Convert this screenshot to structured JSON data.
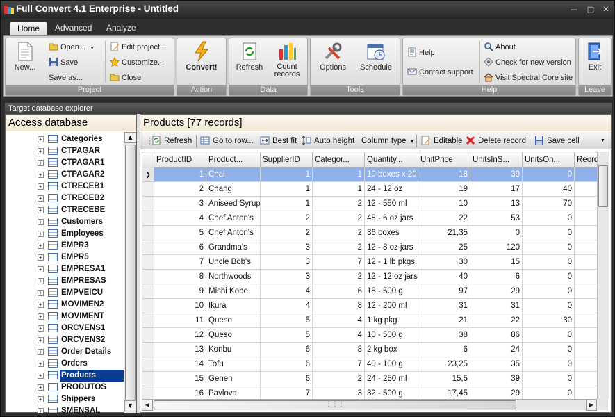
{
  "window": {
    "title": "Full Convert 4.1 Enterprise - Untitled"
  },
  "tabs": [
    {
      "label": "Home"
    },
    {
      "label": "Advanced"
    },
    {
      "label": "Analyze"
    }
  ],
  "ribbon": {
    "groups": {
      "project": "Project",
      "action": "Action",
      "data": "Data",
      "tools": "Tools",
      "help": "Help",
      "leave": "Leave"
    },
    "new": "New...",
    "open": "Open...",
    "save": "Save",
    "save_as": "Save as...",
    "edit_project": "Edit project...",
    "customize": "Customize...",
    "close": "Close",
    "convert": "Convert!",
    "refresh": "Refresh",
    "count_records_1": "Count",
    "count_records_2": "records",
    "options": "Options",
    "schedule": "Schedule",
    "help": "Help",
    "contact_support": "Contact support",
    "about": "About",
    "check_version": "Check for new version",
    "visit_site": "Visit Spectral Core site",
    "exit": "Exit"
  },
  "explorer": {
    "title": "Target database explorer",
    "db_title": "Access database",
    "tables": [
      "Categories",
      "CTPAGAR",
      "CTPAGAR1",
      "CTPAGAR2",
      "CTRECEB1",
      "CTRECEB2",
      "CTRECEBE",
      "Customers",
      "Employees",
      "EMPR3",
      "EMPR5",
      "EMPRESA1",
      "EMPRESAS",
      "EMPVEICU",
      "MOVIMEN2",
      "MOVIMENT",
      "ORCVENS1",
      "ORCVENS2",
      "Order Details",
      "Orders",
      "Products",
      "PRODUTOS",
      "Shippers",
      "SMENSAL"
    ],
    "selected": "Products"
  },
  "grid_panel": {
    "title": "Products [77 records]",
    "toolbar": {
      "refresh": "Refresh",
      "go_to_row": "Go to row...",
      "best_fit": "Best fit",
      "auto_height": "Auto height",
      "column_type": "Column type",
      "editable": "Editable",
      "delete_record": "Delete record",
      "save_cell": "Save cell"
    },
    "columns": [
      "ProductID",
      "Product...",
      "SupplierID",
      "Categor...",
      "Quantity...",
      "UnitPrice",
      "UnitsInS...",
      "UnitsOn...",
      "Reorde"
    ],
    "rows": [
      [
        "1",
        "Chai",
        "1",
        "1",
        "10 boxes x 20",
        "18",
        "39",
        "0"
      ],
      [
        "2",
        "Chang",
        "1",
        "1",
        "24 - 12 oz",
        "19",
        "17",
        "40"
      ],
      [
        "3",
        "Aniseed Syrup",
        "1",
        "2",
        "12 - 550 ml",
        "10",
        "13",
        "70"
      ],
      [
        "4",
        "Chef Anton's",
        "2",
        "2",
        "48 - 6 oz jars",
        "22",
        "53",
        "0"
      ],
      [
        "5",
        "Chef Anton's",
        "2",
        "2",
        "36 boxes",
        "21,35",
        "0",
        "0"
      ],
      [
        "6",
        "Grandma's",
        "3",
        "2",
        "12 - 8 oz jars",
        "25",
        "120",
        "0"
      ],
      [
        "7",
        "Uncle Bob's",
        "3",
        "7",
        "12 - 1 lb pkgs.",
        "30",
        "15",
        "0"
      ],
      [
        "8",
        "Northwoods",
        "3",
        "2",
        "12 - 12 oz jars",
        "40",
        "6",
        "0"
      ],
      [
        "9",
        "Mishi Kobe",
        "4",
        "6",
        "18 - 500 g",
        "97",
        "29",
        "0"
      ],
      [
        "10",
        "Ikura",
        "4",
        "8",
        "12 - 200 ml",
        "31",
        "31",
        "0"
      ],
      [
        "11",
        "Queso",
        "5",
        "4",
        "1 kg pkg.",
        "21",
        "22",
        "30"
      ],
      [
        "12",
        "Queso",
        "5",
        "4",
        "10 - 500 g",
        "38",
        "86",
        "0"
      ],
      [
        "13",
        "Konbu",
        "6",
        "8",
        "2 kg box",
        "6",
        "24",
        "0"
      ],
      [
        "14",
        "Tofu",
        "6",
        "7",
        "40 - 100 g",
        "23,25",
        "35",
        "0"
      ],
      [
        "15",
        "Genen",
        "6",
        "2",
        "24 - 250 ml",
        "15,5",
        "39",
        "0"
      ],
      [
        "16",
        "Pavlova",
        "7",
        "3",
        "32 - 500 g",
        "17,45",
        "29",
        "0"
      ]
    ]
  }
}
